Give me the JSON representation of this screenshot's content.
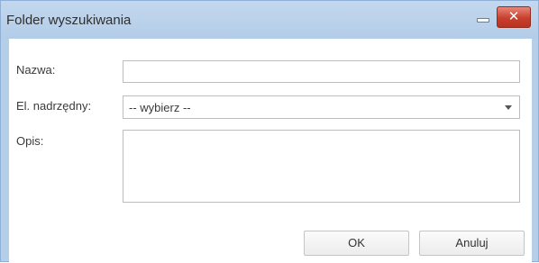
{
  "dialog": {
    "title": "Folder wyszukiwania",
    "close_symbol": "✕"
  },
  "form": {
    "name_label": "Nazwa:",
    "name_value": "",
    "parent_label": "El. nadrzędny:",
    "parent_selected": "-- wybierz --",
    "description_label": "Opis:",
    "description_value": ""
  },
  "buttons": {
    "ok": "OK",
    "cancel": "Anuluj"
  },
  "icons": {
    "minimize": "minimize-icon",
    "close": "close-icon",
    "dropdown": "chevron-down-icon"
  },
  "colors": {
    "titlebar": "#b6cfe9",
    "close_button": "#c8402d"
  }
}
